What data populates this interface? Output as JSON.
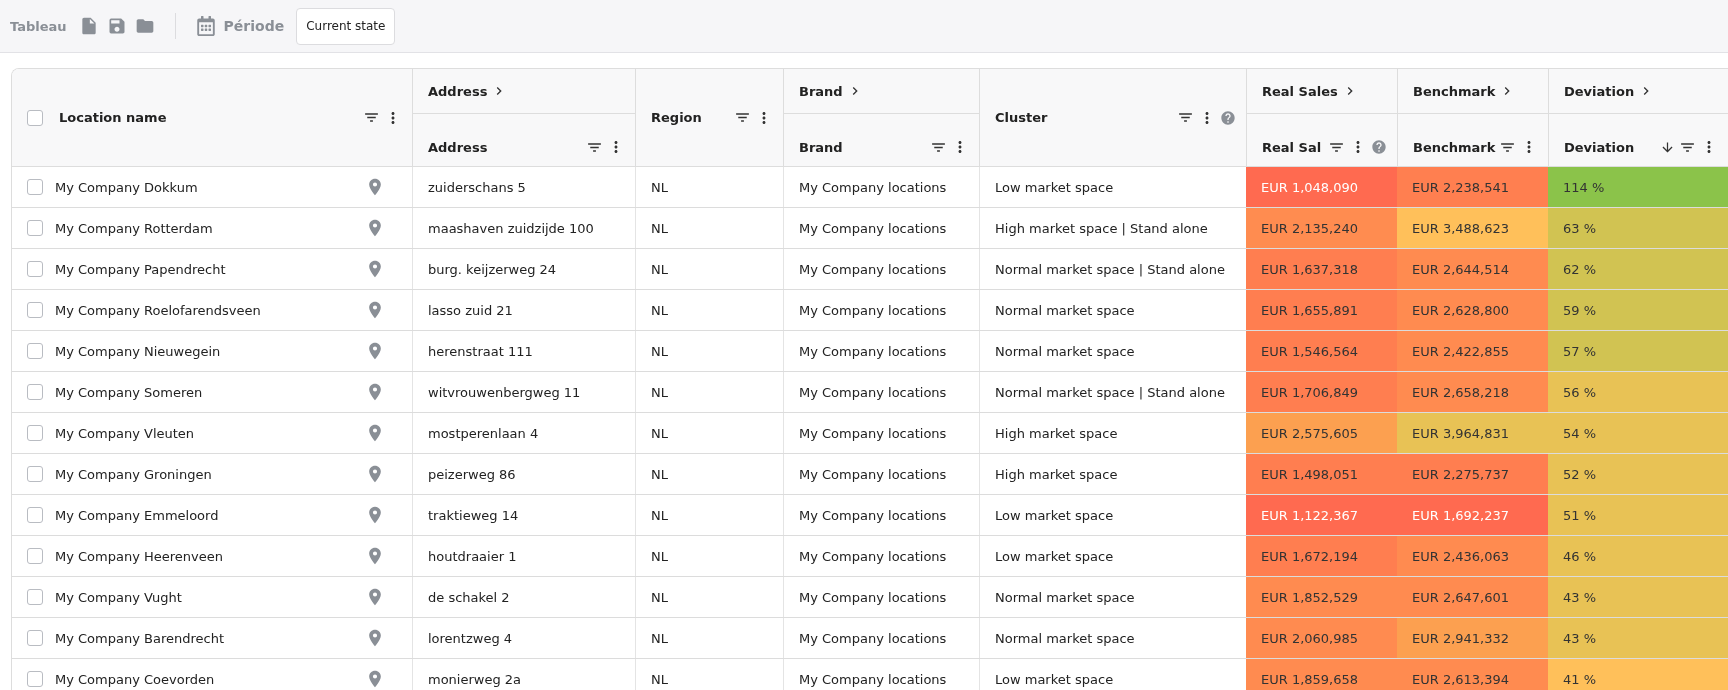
{
  "toolbar": {
    "title": "Tableau",
    "period_label": "Période",
    "period_value": "Current state"
  },
  "header_checkbox": {
    "checked": false
  },
  "columns": [
    {
      "kind": "single",
      "label": "Location name",
      "help": false,
      "sorted_descending": false
    },
    {
      "kind": "grouped",
      "group": "Address",
      "label": "Address",
      "help": false,
      "sorted_descending": false
    },
    {
      "kind": "single",
      "label": "Region",
      "help": false,
      "sorted_descending": false
    },
    {
      "kind": "grouped",
      "group": "Brand",
      "label": "Brand",
      "help": false,
      "sorted_descending": false
    },
    {
      "kind": "single",
      "label": "Cluster",
      "help": true,
      "sorted_descending": false
    },
    {
      "kind": "grouped",
      "group": "Real Sales",
      "label": "Real Sal",
      "help": true,
      "sorted_descending": false
    },
    {
      "kind": "grouped",
      "group": "Benchmark",
      "label": "Benchmark",
      "help": false,
      "sorted_descending": false
    },
    {
      "kind": "grouped",
      "group": "Deviation",
      "label": "Deviation",
      "help": false,
      "sorted_descending": true
    }
  ],
  "rows": [
    {
      "checked": false,
      "location": "My Company Dokkum",
      "address": "zuiderschans 5",
      "region": "NL",
      "brand": "My Company locations",
      "cluster": "Low market space",
      "real_sales": {
        "text": "EUR 1,048,090",
        "color": "#ff6a50"
      },
      "benchmark": {
        "text": "EUR 2,238,541",
        "color": "#ff7f50"
      },
      "deviation": {
        "text": "114 %",
        "color": "#8bc34a"
      }
    },
    {
      "checked": false,
      "location": "My Company Rotterdam",
      "address": "maashaven zuidzijde 100",
      "region": "NL",
      "brand": "My Company locations",
      "cluster": "High market space | Stand alone",
      "real_sales": {
        "text": "EUR 2,135,240",
        "color": "#ff8c50"
      },
      "benchmark": {
        "text": "EUR 3,488,623",
        "color": "#ffc05a"
      },
      "deviation": {
        "text": "63 %",
        "color": "#d1c352"
      }
    },
    {
      "checked": false,
      "location": "My Company Papendrecht",
      "address": "burg. keijzerweg 24",
      "region": "NL",
      "brand": "My Company locations",
      "cluster": "Normal market space | Stand alone",
      "real_sales": {
        "text": "EUR 1,637,318",
        "color": "#ff7e50"
      },
      "benchmark": {
        "text": "EUR 2,644,514",
        "color": "#ff8b50"
      },
      "deviation": {
        "text": "62 %",
        "color": "#d1c352"
      }
    },
    {
      "checked": false,
      "location": "My Company Roelofarendsveen",
      "address": "lasso zuid 21",
      "region": "NL",
      "brand": "My Company locations",
      "cluster": "Normal market space",
      "real_sales": {
        "text": "EUR 1,655,891",
        "color": "#ff7e50"
      },
      "benchmark": {
        "text": "EUR 2,628,800",
        "color": "#ff8b50"
      },
      "deviation": {
        "text": "59 %",
        "color": "#d1c352"
      }
    },
    {
      "checked": false,
      "location": "My Company Nieuwegein",
      "address": "herenstraat 111",
      "region": "NL",
      "brand": "My Company locations",
      "cluster": "Normal market space",
      "real_sales": {
        "text": "EUR 1,546,564",
        "color": "#ff7e50"
      },
      "benchmark": {
        "text": "EUR 2,422,855",
        "color": "#ff8b50"
      },
      "deviation": {
        "text": "57 %",
        "color": "#d1c352"
      }
    },
    {
      "checked": false,
      "location": "My Company Someren",
      "address": "witvrouwenbergweg 11",
      "region": "NL",
      "brand": "My Company locations",
      "cluster": "Normal market space | Stand alone",
      "real_sales": {
        "text": "EUR 1,706,849",
        "color": "#ff7e50"
      },
      "benchmark": {
        "text": "EUR 2,658,218",
        "color": "#ff8b50"
      },
      "deviation": {
        "text": "56 %",
        "color": "#e8c255"
      }
    },
    {
      "checked": false,
      "location": "My Company Vleuten",
      "address": "mostperenlaan 4",
      "region": "NL",
      "brand": "My Company locations",
      "cluster": "High market space",
      "real_sales": {
        "text": "EUR 2,575,605",
        "color": "#fca050"
      },
      "benchmark": {
        "text": "EUR 3,964,831",
        "color": "#e8c255"
      },
      "deviation": {
        "text": "54 %",
        "color": "#e8c255"
      }
    },
    {
      "checked": false,
      "location": "My Company Groningen",
      "address": "peizerweg 86",
      "region": "NL",
      "brand": "My Company locations",
      "cluster": "High market space",
      "real_sales": {
        "text": "EUR 1,498,051",
        "color": "#ff7e50"
      },
      "benchmark": {
        "text": "EUR 2,275,737",
        "color": "#ff7e50"
      },
      "deviation": {
        "text": "52 %",
        "color": "#e8c255"
      }
    },
    {
      "checked": false,
      "location": "My Company Emmeloord",
      "address": "traktieweg 14",
      "region": "NL",
      "brand": "My Company locations",
      "cluster": "Low market space",
      "real_sales": {
        "text": "EUR 1,122,367",
        "color": "#ff6a50"
      },
      "benchmark": {
        "text": "EUR 1,692,237",
        "color": "#ff6a50"
      },
      "deviation": {
        "text": "51 %",
        "color": "#e8c255"
      }
    },
    {
      "checked": false,
      "location": "My Company Heerenveen",
      "address": "houtdraaier 1",
      "region": "NL",
      "brand": "My Company locations",
      "cluster": "Low market space",
      "real_sales": {
        "text": "EUR 1,672,194",
        "color": "#ff7e50"
      },
      "benchmark": {
        "text": "EUR 2,436,063",
        "color": "#ff8b50"
      },
      "deviation": {
        "text": "46 %",
        "color": "#e8c255"
      }
    },
    {
      "checked": false,
      "location": "My Company Vught",
      "address": "de schakel 2",
      "region": "NL",
      "brand": "My Company locations",
      "cluster": "Normal market space",
      "real_sales": {
        "text": "EUR 1,852,529",
        "color": "#ff8b50"
      },
      "benchmark": {
        "text": "EUR 2,647,601",
        "color": "#ff8b50"
      },
      "deviation": {
        "text": "43 %",
        "color": "#e8c255"
      }
    },
    {
      "checked": false,
      "location": "My Company Barendrecht",
      "address": "lorentzweg 4",
      "region": "NL",
      "brand": "My Company locations",
      "cluster": "Normal market space",
      "real_sales": {
        "text": "EUR 2,060,985",
        "color": "#ff8b50"
      },
      "benchmark": {
        "text": "EUR 2,941,332",
        "color": "#fca050"
      },
      "deviation": {
        "text": "43 %",
        "color": "#e8c255"
      }
    },
    {
      "checked": false,
      "location": "My Company Coevorden",
      "address": "monierweg 2a",
      "region": "NL",
      "brand": "My Company locations",
      "cluster": "Low market space",
      "real_sales": {
        "text": "EUR 1,859,658",
        "color": "#ff8b50"
      },
      "benchmark": {
        "text": "EUR 2,613,394",
        "color": "#ff8b50"
      },
      "deviation": {
        "text": "41 %",
        "color": "#ffc05a"
      }
    }
  ]
}
